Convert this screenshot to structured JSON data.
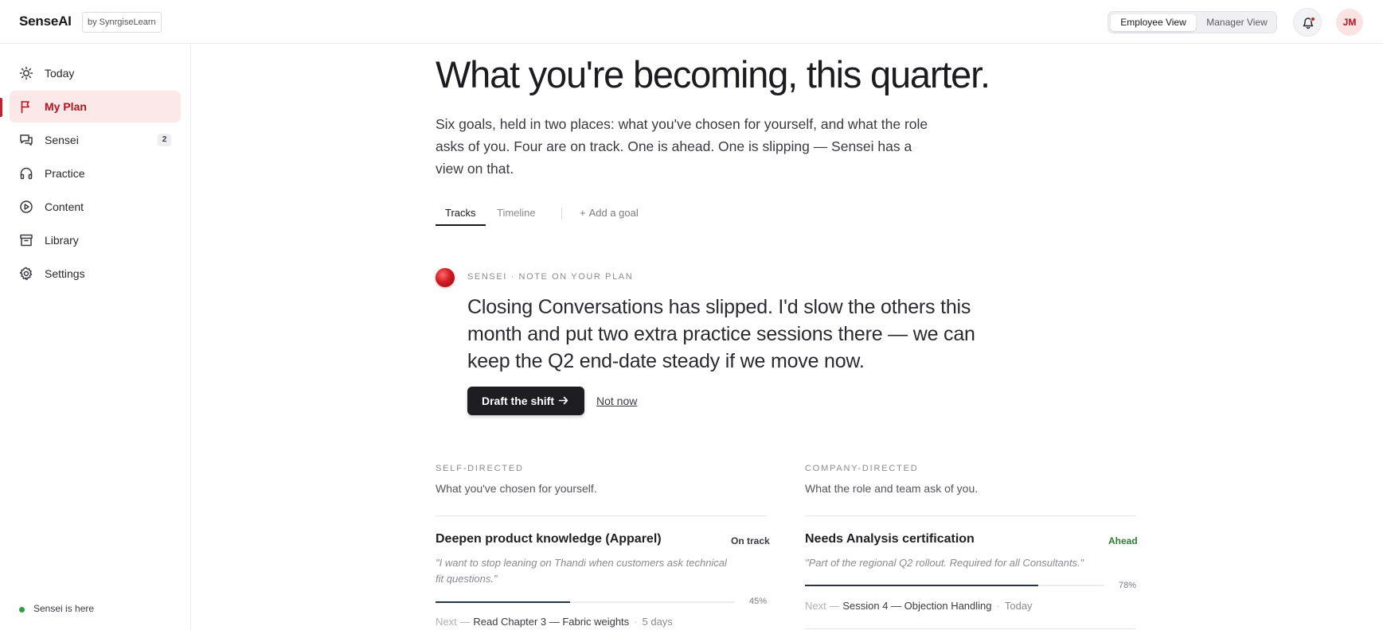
{
  "app": {
    "brand": "SenseAI",
    "brand_tag": "by SynrgiseLearn"
  },
  "header": {
    "view_toggle": {
      "employee": "Employee View",
      "manager": "Manager View",
      "selected": "Employee View"
    },
    "notifications_icon": "bell-icon",
    "avatar_initials": "JM"
  },
  "sidebar": {
    "items": [
      {
        "label": "Today",
        "icon": "sun-icon"
      },
      {
        "label": "My Plan",
        "icon": "flag-icon",
        "active": true
      },
      {
        "label": "Sensei",
        "icon": "chat-icon",
        "badge": "2"
      },
      {
        "label": "Practice",
        "icon": "headphones-icon"
      },
      {
        "label": "Content",
        "icon": "play-circle-icon"
      },
      {
        "label": "Library",
        "icon": "archive-icon"
      },
      {
        "label": "Settings",
        "icon": "gear-icon"
      }
    ],
    "status": "Sensei is here"
  },
  "main": {
    "title": "What you're becoming, this quarter.",
    "subtitle": "Six goals, held in two places: what you've chosen for yourself, and what the role asks of you. Four are on track. One is ahead. One is slipping — Sensei has a view on that.",
    "tabs": [
      {
        "label": "Tracks",
        "active": true
      },
      {
        "label": "Timeline"
      }
    ],
    "add_goal": "Add a goal",
    "note": {
      "label": "SENSEI · NOTE ON YOUR PLAN",
      "body": "Closing Conversations has slipped. I'd slow the others this month and put two extra practice sessions there — we can keep the Q2 end-date steady if we move now.",
      "primary_action": "Draft the shift",
      "secondary_action": "Not now"
    },
    "columns": {
      "self": {
        "label": "SELF-DIRECTED",
        "sub": "What you've chosen for yourself.",
        "goals": [
          {
            "title": "Deepen product knowledge (Apparel)",
            "status": "On track",
            "quote": "\"I want to stop leaning on Thandi when customers ask technical fit questions.\"",
            "progress": 45,
            "progress_label": "45%",
            "next_prefix": "Next —",
            "next": "Read Chapter 3 — Fabric weights",
            "due": "5 days"
          }
        ]
      },
      "company": {
        "label": "COMPANY-DIRECTED",
        "sub": "What the role and team ask of you.",
        "goals": [
          {
            "title": "Needs Analysis certification",
            "status": "Ahead",
            "quote": "\"Part of the regional Q2 rollout. Required for all Consultants.\"",
            "progress": 78,
            "progress_label": "78%",
            "next_prefix": "Next —",
            "next": "Session 4 — Objection Handling",
            "due": "Today"
          }
        ]
      }
    }
  },
  "colors": {
    "accent": "#c8202a",
    "active_bg": "#fde8e9",
    "on_track": "#3a3a42",
    "ahead": "#2f7d32",
    "progress_fill": "#2a3448"
  }
}
